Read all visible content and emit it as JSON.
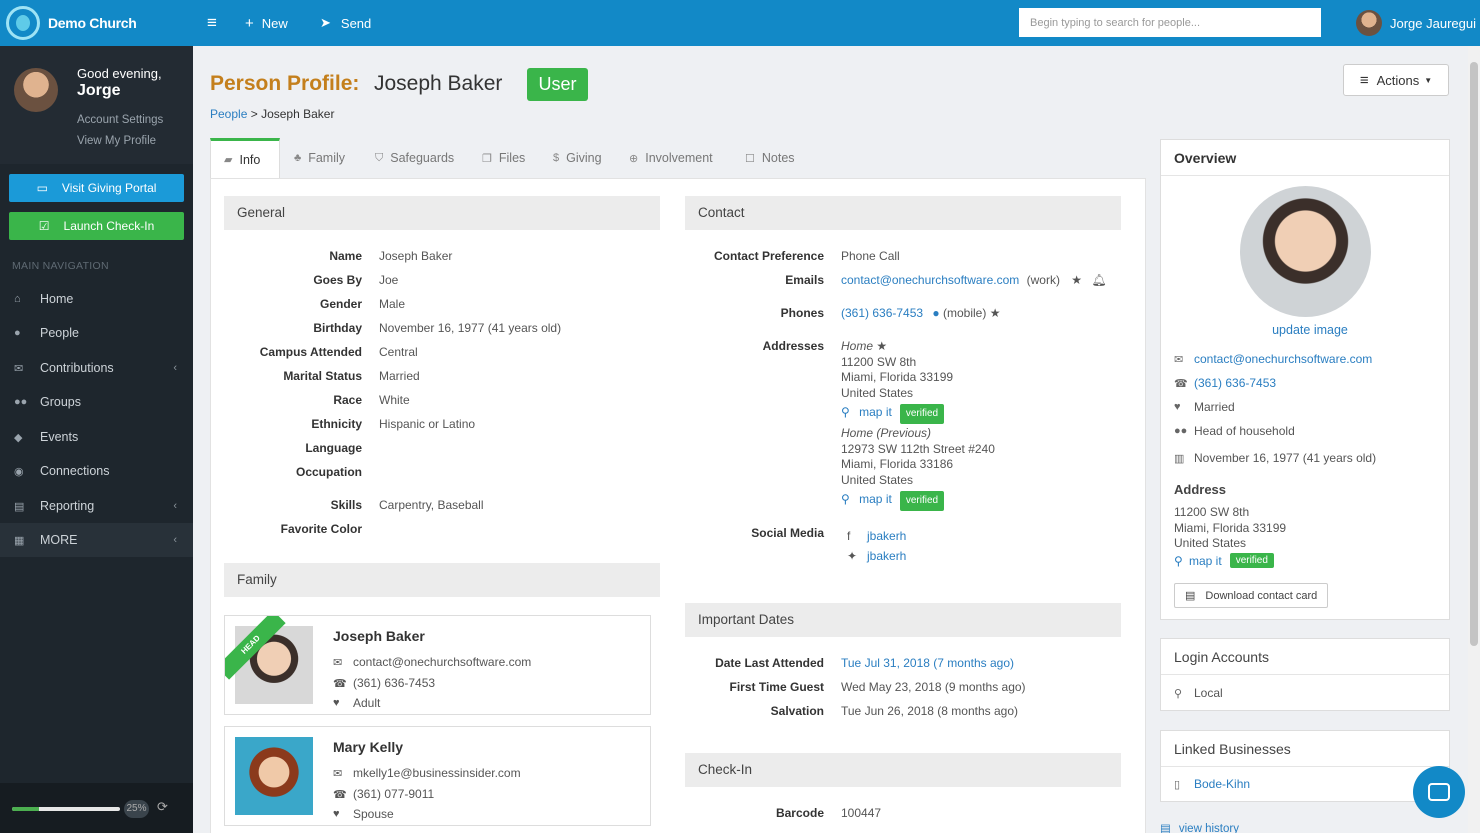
{
  "sidebar": {
    "brand": "Demo Church",
    "greeting": "Good evening,",
    "user_first": "Jorge",
    "account_settings": "Account Settings",
    "view_profile": "View My Profile",
    "giving_btn": "Visit Giving Portal",
    "checkin_btn": "Launch Check-In",
    "nav_header": "MAIN NAVIGATION",
    "nav": [
      "Home",
      "People",
      "Contributions",
      "Groups",
      "Events",
      "Connections",
      "Reporting",
      "MORE"
    ],
    "progress_pct": "25%",
    "progress_value": 0.25
  },
  "topbar": {
    "new_label": "New",
    "send_label": "Send",
    "search_placeholder": "Begin typing to search for people...",
    "user_name": "Jorge Jauregui"
  },
  "page": {
    "title_prefix": "Person Profile:",
    "person_name": "Joseph Baker",
    "badge": "User",
    "breadcrumb_root": "People",
    "breadcrumb_sep": ">",
    "breadcrumb_current": "Joseph Baker",
    "actions_label": "Actions"
  },
  "tabs": [
    "Info",
    "Family",
    "Safeguards",
    "Files",
    "Giving",
    "Involvement",
    "Notes"
  ],
  "general": {
    "header": "General",
    "fields": [
      {
        "label": "Name",
        "value": "Joseph Baker"
      },
      {
        "label": "Goes By",
        "value": "Joe"
      },
      {
        "label": "Gender",
        "value": "Male"
      },
      {
        "label": "Birthday",
        "value": "November 16, 1977 (41 years old)"
      },
      {
        "label": "Campus Attended",
        "value": "Central"
      },
      {
        "label": "Marital Status",
        "value": "Married"
      },
      {
        "label": "Race",
        "value": "White"
      },
      {
        "label": "Ethnicity",
        "value": "Hispanic or Latino"
      },
      {
        "label": "Language",
        "value": ""
      },
      {
        "label": "Occupation",
        "value": ""
      },
      {
        "label": "Skills",
        "value": "Carpentry, Baseball"
      },
      {
        "label": "Favorite Color",
        "value": ""
      }
    ]
  },
  "family": {
    "header": "Family",
    "head_ribbon": "HEAD",
    "members": [
      {
        "name": "Joseph Baker",
        "email": "contact@onechurchsoftware.com",
        "phone": "(361) 636-7453",
        "role": "Adult"
      },
      {
        "name": "Mary Kelly",
        "email": "mkelly1e@businessinsider.com",
        "phone": "(361) 077-9011",
        "role": "Spouse"
      }
    ]
  },
  "contact": {
    "header": "Contact",
    "pref_label": "Contact Preference",
    "pref_value": "Phone Call",
    "emails_label": "Emails",
    "email": "contact@onechurchsoftware.com",
    "email_type": "(work)",
    "phones_label": "Phones",
    "phone": "(361) 636-7453",
    "phone_type": "(mobile)",
    "addresses_label": "Addresses",
    "addr1_title": "Home",
    "addr1_l1": "11200 SW 8th",
    "addr1_l2": "Miami, Florida 33199",
    "addr1_l3": "United States",
    "addr2_title": "Home (Previous)",
    "addr2_l1": "12973 SW 112th Street #240",
    "addr2_l2": "Miami, Florida 33186",
    "addr2_l3": "United States",
    "map_it": "map it",
    "verified": "verified",
    "social_label": "Social Media",
    "facebook": "jbakerh",
    "twitter": "jbakerh"
  },
  "dates": {
    "header": "Important Dates",
    "last_attended_label": "Date Last Attended",
    "last_attended_value": "Tue Jul 31, 2018 (7 months ago)",
    "first_guest_label": "First Time Guest",
    "first_guest_value": "Wed May 23, 2018 (9 months ago)",
    "salvation_label": "Salvation",
    "salvation_value": "Tue Jun 26, 2018 (8 months ago)"
  },
  "checkin": {
    "header": "Check-In",
    "barcode_label": "Barcode",
    "barcode_value": "100447"
  },
  "overview": {
    "header": "Overview",
    "update_image": "update image",
    "email": "contact@onechurchsoftware.com",
    "phone": "(361) 636-7453",
    "marital": "Married",
    "household": "Head of household",
    "birthday": "November 16, 1977 (41 years old)",
    "address_header": "Address",
    "addr_l1": "11200 SW 8th",
    "addr_l2": "Miami, Florida 33199",
    "addr_l3": "United States",
    "map_it": "map it",
    "verified": "verified",
    "download_card": "Download contact card"
  },
  "login": {
    "header": "Login Accounts",
    "item": "Local"
  },
  "linked": {
    "header": "Linked Businesses",
    "item": "Bode-Kihn"
  },
  "history_link": "view history",
  "colors": {
    "primary": "#1289c7",
    "accent": "#3ab54a",
    "title": "#c47f1c",
    "sidebar": "#1e262d"
  }
}
